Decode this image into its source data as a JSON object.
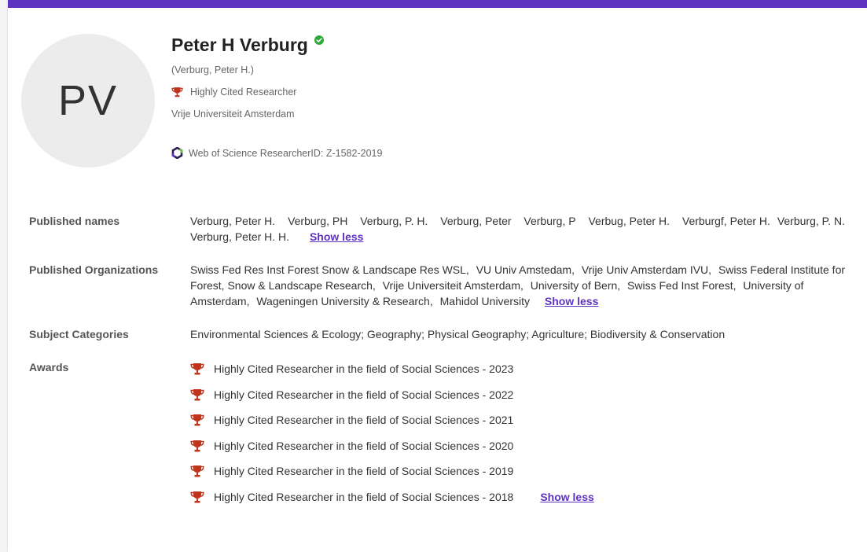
{
  "profile": {
    "initials": "PV",
    "name": "Peter H Verburg",
    "alt_name": "(Verburg, Peter H.)",
    "badge": "Highly Cited Researcher",
    "institution": "Vrije Universiteit Amsterdam",
    "researcher_id_label": "Web of Science ResearcherID: Z-1582-2019"
  },
  "details": {
    "published_names": {
      "label": "Published names",
      "items": [
        "Verburg, Peter H.",
        "Verburg, PH",
        "Verburg, P. H.",
        "Verburg, Peter",
        "Verburg, P",
        "Verbug, Peter H.",
        "Verburgf, Peter H.",
        "Verburg, P. N.",
        "Verburg, Peter H. H."
      ],
      "show_less": "Show less"
    },
    "published_organizations": {
      "label": "Published Organizations",
      "items": [
        "Swiss Fed Res Inst Forest Snow & Landscape Res WSL,",
        "VU Univ Amstedam,",
        "Vrije Univ Amsterdam IVU,",
        "Swiss Federal Institute for Forest, Snow & Landscape Research,",
        "Vrije Universiteit Amsterdam,",
        "University of Bern,",
        "Swiss Fed Inst Forest,",
        "University of Amsterdam,",
        "Wageningen University & Research,",
        "Mahidol University"
      ],
      "show_less": "Show less"
    },
    "subject_categories": {
      "label": "Subject Categories",
      "value": "Environmental Sciences & Ecology;  Geography;  Physical Geography;  Agriculture;  Biodiversity & Conservation"
    },
    "awards": {
      "label": "Awards",
      "items": [
        "Highly Cited Researcher in the field of Social Sciences - 2023",
        "Highly Cited Researcher in the field of Social Sciences - 2022",
        "Highly Cited Researcher in the field of Social Sciences - 2021",
        "Highly Cited Researcher in the field of Social Sciences - 2020",
        "Highly Cited Researcher in the field of Social Sciences - 2019",
        "Highly Cited Researcher in the field of Social Sciences - 2018"
      ],
      "show_less": "Show less"
    }
  },
  "icons": {
    "verified": "check-circle-icon",
    "trophy": "trophy-icon",
    "researcher_id": "wos-logo-icon"
  },
  "colors": {
    "accent": "#5e33bf",
    "trophy": "#c0341d",
    "verified": "#2eaa3a"
  }
}
